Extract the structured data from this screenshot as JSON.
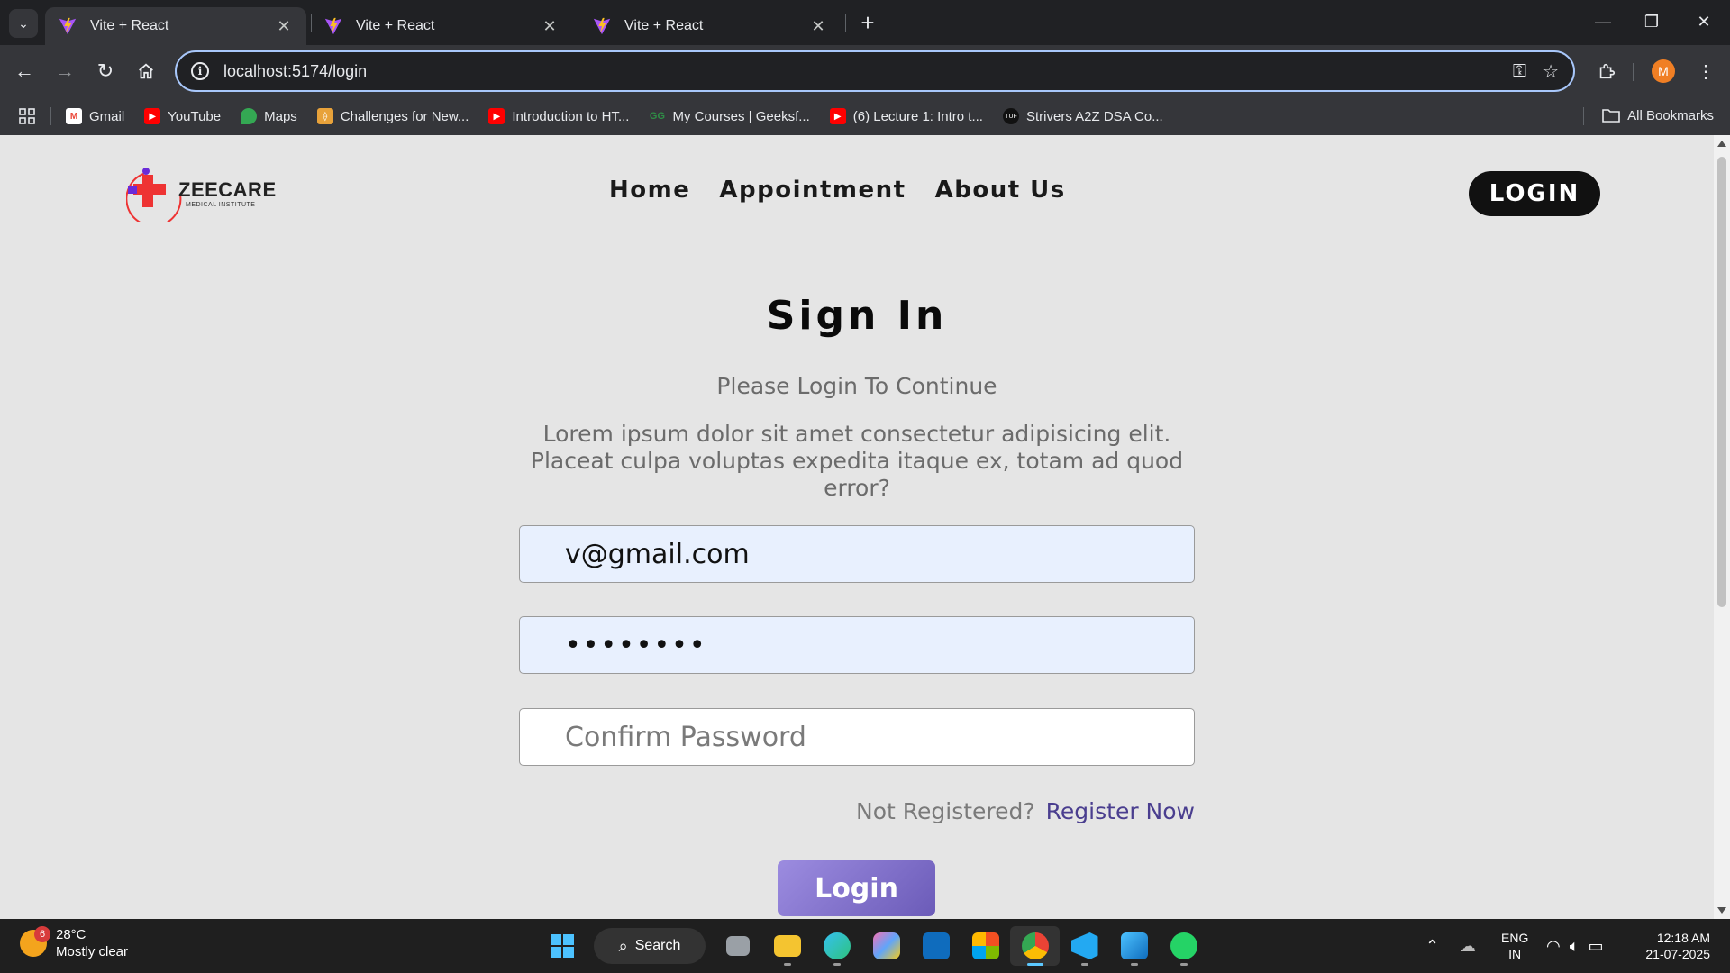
{
  "browser": {
    "tabs": [
      {
        "title": "Vite + React",
        "active": true
      },
      {
        "title": "Vite + React",
        "active": false
      },
      {
        "title": "Vite + React",
        "active": false
      }
    ],
    "url": "localhost:5174/login",
    "profile_initial": "M",
    "bookmarks": [
      {
        "label": "Gmail",
        "icon": "gmail-icon",
        "color": "#ea4335"
      },
      {
        "label": "YouTube",
        "icon": "youtube-icon",
        "color": "#ff0000"
      },
      {
        "label": "Maps",
        "icon": "maps-icon",
        "color": "#34a853"
      },
      {
        "label": "Challenges for New...",
        "icon": "challenges-icon",
        "color": "#e8a23a"
      },
      {
        "label": "Introduction to HT...",
        "icon": "youtube-icon",
        "color": "#ff0000"
      },
      {
        "label": "My Courses | Geeksf...",
        "icon": "geeksforgeeks-icon",
        "color": "#2f8d46"
      },
      {
        "label": "(6) Lecture 1: Intro t...",
        "icon": "youtube-icon",
        "color": "#ff0000"
      },
      {
        "label": "Strivers A2Z DSA Co...",
        "icon": "tuf-icon",
        "color": "#111111"
      }
    ],
    "all_bookmarks_label": "All Bookmarks"
  },
  "site": {
    "logo_text": "ZEECARE",
    "logo_subtext": "MEDICAL INSTITUTE",
    "nav": [
      "Home",
      "Appointment",
      "About Us"
    ],
    "login_button": "LOGIN"
  },
  "form": {
    "title": "Sign In",
    "subtitle": "Please Login To Continue",
    "description": "Lorem ipsum dolor sit amet consectetur adipisicing elit. Placeat culpa voluptas expedita itaque ex, totam ad quod error?",
    "email_value": "v@gmail.com",
    "password_value": "12345678",
    "confirm_placeholder": "Confirm Password",
    "not_registered": "Not Registered?",
    "register_link": "Register Now",
    "submit_label": "Login"
  },
  "taskbar": {
    "weather_badge": "6",
    "temperature": "28°C",
    "weather_desc": "Mostly clear",
    "search_label": "Search",
    "lang_line1": "ENG",
    "lang_line2": "IN",
    "time": "12:18 AM",
    "date": "21-07-2025"
  },
  "colors": {
    "page_bg": "#e5e5e5",
    "accent_purple": "#6b5bb8",
    "register_link": "#4a3e8f",
    "autofill_bg": "#e8f0fe"
  }
}
